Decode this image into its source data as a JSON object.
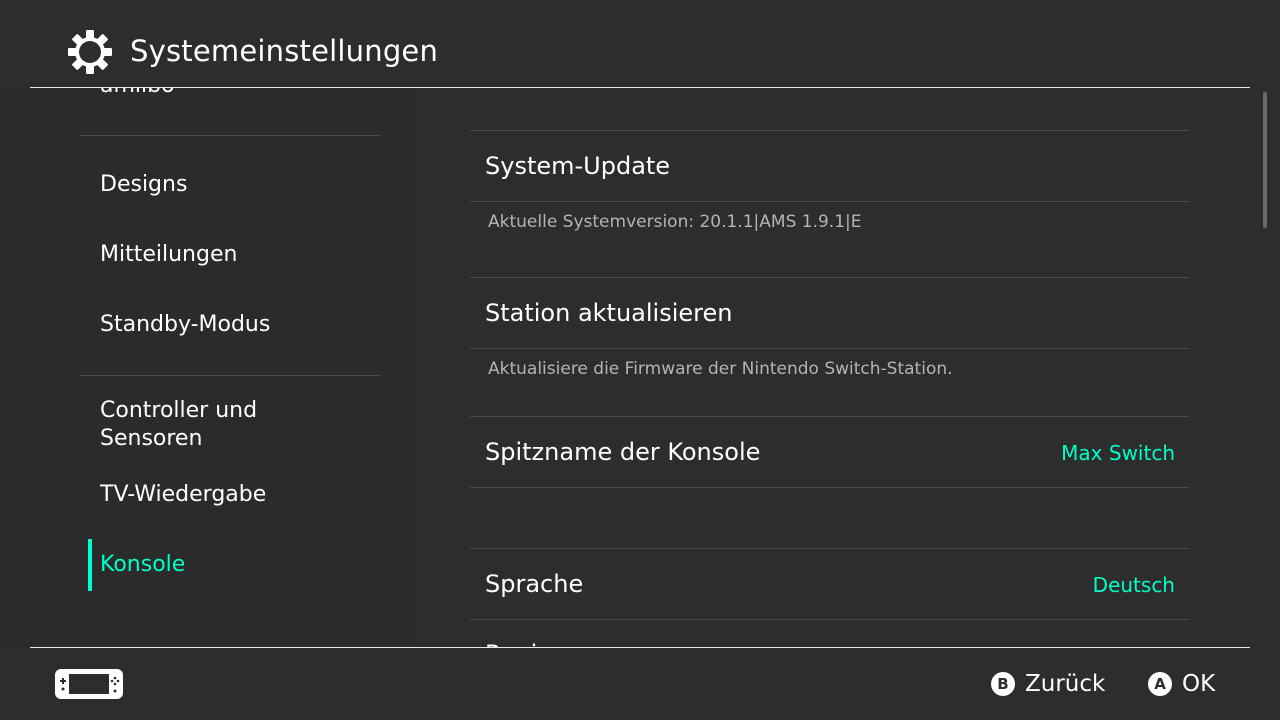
{
  "header": {
    "title": "Systemeinstellungen",
    "icon": "gear-icon"
  },
  "sidebar": {
    "items": [
      {
        "label": "amiibo"
      },
      {
        "label": "Designs"
      },
      {
        "label": "Mitteilungen"
      },
      {
        "label": "Standby-Modus"
      },
      {
        "label": "Controller und\nSensoren"
      },
      {
        "label": "TV-Wiedergabe"
      },
      {
        "label": "Konsole",
        "active": true
      }
    ]
  },
  "main": {
    "rows": [
      {
        "title": "System-Update",
        "description": "Aktuelle Systemversion: 20.1.1|AMS 1.9.1|E"
      },
      {
        "title": "Station aktualisieren",
        "description": "Aktualisiere die Firmware der Nintendo Switch-Station."
      },
      {
        "title": "Spitzname der Konsole",
        "value": "Max Switch"
      },
      {
        "title": "Sprache",
        "value": "Deutsch"
      },
      {
        "title": "Region"
      }
    ]
  },
  "footer": {
    "back": {
      "button": "B",
      "label": "Zurück"
    },
    "ok": {
      "button": "A",
      "label": "OK"
    },
    "console_icon": "handheld-console-icon"
  },
  "colors": {
    "background": "#2d2d2d",
    "accent": "#00ffc8",
    "text": "#ffffff",
    "muted_text": "#b4b4b4"
  }
}
